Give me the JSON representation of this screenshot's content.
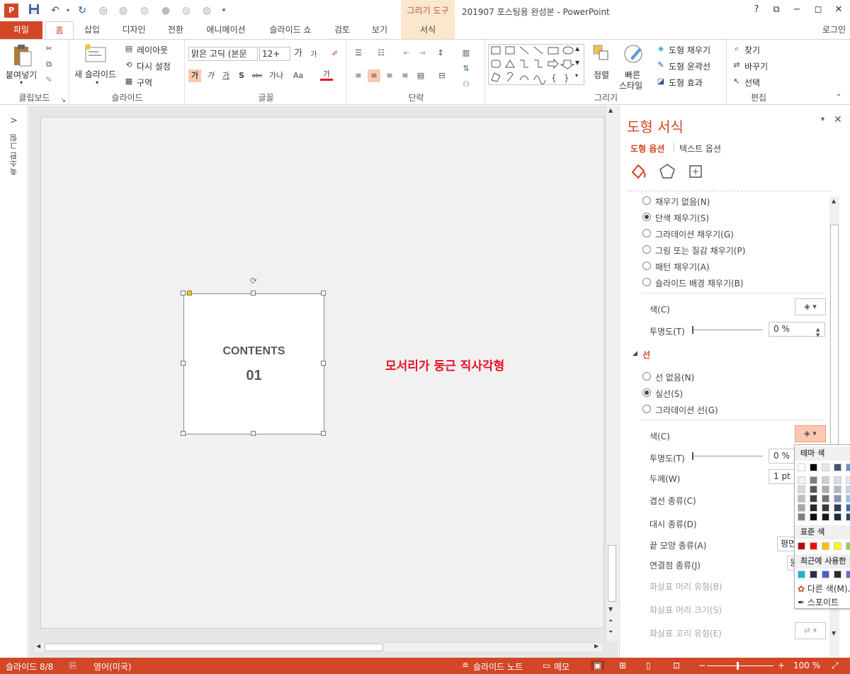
{
  "window": {
    "context_tab_group": "그리기 도구",
    "title": "201907 포스팅용 완성본 - PowerPoint",
    "help": "?",
    "minimize": "−",
    "restore": "◻",
    "close": "✕",
    "restore_ribbon": "⧉"
  },
  "tabs": {
    "file": "파일",
    "home": "홈",
    "insert": "삽입",
    "design": "디자인",
    "transitions": "전환",
    "animations": "애니메이션",
    "slideshow": "슬라이드 쇼",
    "review": "검토",
    "view": "보기",
    "format": "서식",
    "login": "로그인"
  },
  "ribbon": {
    "clipboard": {
      "label": "클립보드",
      "paste": "붙여넣기"
    },
    "slides": {
      "label": "슬라이드",
      "new_slide": "새 슬라이드",
      "layout": "레이아웃",
      "reset": "다시 설정",
      "section": "구역"
    },
    "font": {
      "label": "글꼴",
      "font_name": "맑은 고딕 (본문",
      "font_size": "12+",
      "grow": "가",
      "shrink": "가",
      "bold": "가",
      "italic": "가",
      "underline": "가",
      "shadow": "S",
      "strike": "abc",
      "spacing": "가나",
      "case": "Aa",
      "color": "가"
    },
    "paragraph": {
      "label": "단락"
    },
    "drawing": {
      "label": "그리기",
      "arrange": "정렬",
      "quick_styles": "빠른\n스타일",
      "quick_styles_1": "빠른",
      "quick_styles_2": "스타일",
      "shape_fill": "도형 채우기",
      "shape_outline": "도형 윤곽선",
      "shape_effects": "도형 효과"
    },
    "editing": {
      "label": "편집",
      "find": "찾기",
      "replace": "바꾸기",
      "select": "선택"
    }
  },
  "thumbpane": {
    "label": "축소판 그림",
    "toggle": ">"
  },
  "slide": {
    "shape_title": "CONTENTS",
    "shape_number": "01",
    "caption": "모서리가 둥근 직사각형"
  },
  "format_pane": {
    "title": "도형 서식",
    "tab_shape": "도형 옵션",
    "tab_text": "텍스트 옵션",
    "fill_options": [
      {
        "label": "채우기 없음(N)",
        "selected": false
      },
      {
        "label": "단색 채우기(S)",
        "selected": true
      },
      {
        "label": "그라데이션 채우기(G)",
        "selected": false
      },
      {
        "label": "그림 또는 질감 채우기(P)",
        "selected": false
      },
      {
        "label": "패턴 채우기(A)",
        "selected": false
      },
      {
        "label": "슬라이드 배경 채우기(B)",
        "selected": false
      }
    ],
    "fill_color_label": "색(C)",
    "fill_transparency_label": "투명도(T)",
    "fill_transparency_value": "0 %",
    "line_section": "선",
    "line_options": [
      {
        "label": "선 없음(N)",
        "selected": false
      },
      {
        "label": "실선(S)",
        "selected": true
      },
      {
        "label": "그라데이션 선(G)",
        "selected": false
      }
    ],
    "line_color_label": "색(C)",
    "line_transparency_label": "투명도(T)",
    "line_transparency_value": "0 %",
    "line_width_label": "두께(W)",
    "line_width_value": "1 pt",
    "compound_label": "겹선 종류(C)",
    "dash_label": "대시 종류(D)",
    "cap_label": "끝 모양 종류(A)",
    "cap_value": "평면",
    "join_label": "연결점 종류(J)",
    "join_value": "둥",
    "arrow_begin_type": "화살표 머리 유형(B)",
    "arrow_begin_size": "화살표 머리 크기(S)",
    "arrow_end_type": "화살표 꼬리 유형(E)"
  },
  "color_popup": {
    "theme_colors": "테마 색",
    "standard_colors": "표준 색",
    "recent_colors": "최근에 사용한",
    "more_colors": "다른 색(M)...",
    "eyedropper": "스포이트",
    "theme_top": [
      "#ffffff",
      "#000000",
      "#e7e6e6",
      "#44546a",
      "#5b9bd5"
    ],
    "standard": [
      "#c00000",
      "#ff0000",
      "#ffc000",
      "#ffff00",
      "#92d050"
    ],
    "recent": [
      "#17b7c8",
      "#2e2e48",
      "#4b5fc6",
      "#2b2b2b",
      "#5a6fd8"
    ]
  },
  "status": {
    "slide": "슬라이드 8/8",
    "language": "영어(미국)",
    "notes": "슬라이드 노트",
    "comments": "메모",
    "zoom": "100 %"
  },
  "colors": {
    "accent": "#d24726",
    "caption": "#e81123"
  }
}
